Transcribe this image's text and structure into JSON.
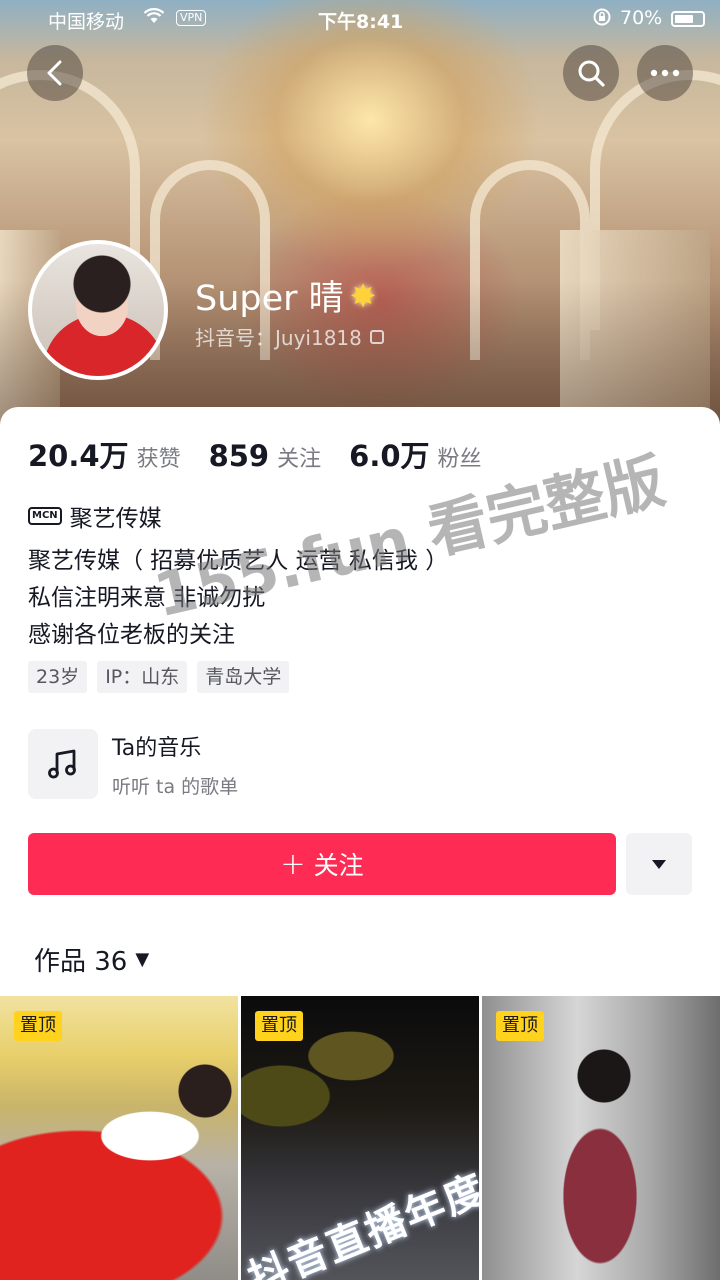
{
  "status_bar": {
    "carrier": "中国移动",
    "vpn": "VPN",
    "time": "下午8:41",
    "battery": "70%"
  },
  "profile": {
    "nickname": "Super 晴",
    "douyin_id": "抖音号：Juyi1818"
  },
  "stats": [
    {
      "value": "20.4万",
      "label": "获赞"
    },
    {
      "value": "859",
      "label": "关注"
    },
    {
      "value": "6.0万",
      "label": "粉丝"
    }
  ],
  "mcn": {
    "badge": "MCN",
    "name": "聚艺传媒"
  },
  "bio": [
    "聚艺传媒（ 招募优质艺人 运营  私信我 ）",
    "私信注明来意  非诚勿扰",
    "感谢各位老板的关注"
  ],
  "tags": [
    "23岁",
    "IP：山东",
    "青岛大学"
  ],
  "music": {
    "title": "Ta的音乐",
    "subtitle": "听听 ta 的歌单"
  },
  "actions": {
    "follow_plus": "+",
    "follow_label": "关注"
  },
  "works": {
    "tab_label": "作品 36",
    "items": [
      {
        "badge": "置顶"
      },
      {
        "badge": "置顶",
        "sign_text": "抖音直播年度盛典"
      },
      {
        "badge": "置顶"
      }
    ]
  },
  "watermark": "155.fun 看完整版",
  "colors": {
    "accent": "#fe2c55",
    "pin_badge": "#ffd21d"
  }
}
